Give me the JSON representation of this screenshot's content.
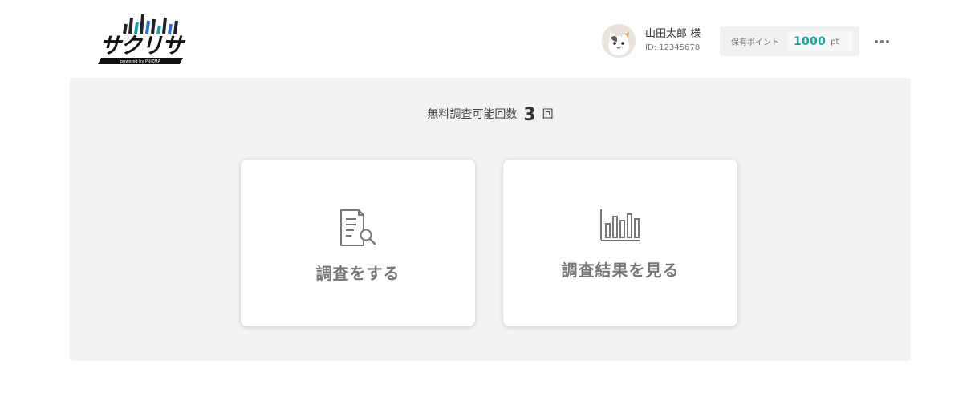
{
  "header": {
    "logo": {
      "wordmark": "サクリサ",
      "tagline": "powered by PRIZMA"
    },
    "user": {
      "name": "山田太郎 様",
      "id": "ID: 12345678",
      "avatar_icon": "cat-avatar-icon"
    },
    "points": {
      "label": "保有ポイント",
      "value": "1000",
      "unit": "pt"
    },
    "menu_icon": "more-dots-icon"
  },
  "main": {
    "counter": {
      "label": "無料調査可能回数",
      "value": "3",
      "unit": "回"
    },
    "cards": [
      {
        "label": "調査をする",
        "icon": "document-search-icon"
      },
      {
        "label": "調査結果を見る",
        "icon": "bar-chart-icon"
      }
    ]
  },
  "colors": {
    "accent": "#1aa3a0",
    "panel_bg": "#f3f3f3",
    "card_text": "#777777"
  }
}
